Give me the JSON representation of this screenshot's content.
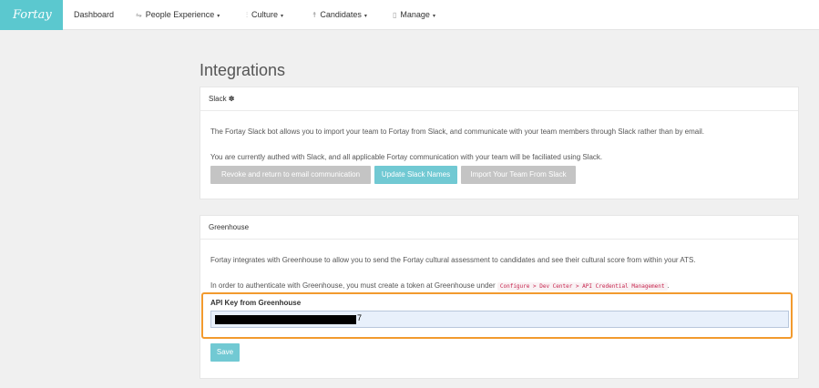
{
  "nav": {
    "logo": "Fortay",
    "dashboard": "Dashboard",
    "people": "People Experience",
    "culture": "Culture",
    "candidates": "Candidates",
    "manage": "Manage",
    "caret": "▾"
  },
  "page": {
    "title": "Integrations"
  },
  "slack": {
    "heading": "Slack ✽",
    "description": "The Fortay Slack bot allows you to import your team to Fortay from Slack, and communicate with your team members through Slack rather than by email.",
    "status": "You are currently authed with Slack, and all applicable Fortay communication with your team will be faciliated using Slack.",
    "revoke_button": "Revoke and return to email communication",
    "update_button": "Update Slack Names",
    "import_button": "Import Your Team From Slack"
  },
  "greenhouse": {
    "heading": "Greenhouse",
    "description": "Fortay integrates with Greenhouse to allow you to send the Fortay cultural assessment to candidates and see their cultural score from within your ATS.",
    "auth_prefix": "In order to authenticate with Greenhouse, you must create a token at Greenhouse under",
    "auth_path": "Configure > Dev Center > API Credential Management",
    "auth_suffix": ".",
    "api_label": "API Key from Greenhouse",
    "api_tail": "7",
    "save_button": "Save"
  },
  "colors": {
    "brand": "#5bc8cf",
    "primary_button": "#71c9d3",
    "highlight": "#f29a2e"
  },
  "icons": [
    "people-icon",
    "culture-icon",
    "candidates-icon",
    "manage-icon"
  ]
}
